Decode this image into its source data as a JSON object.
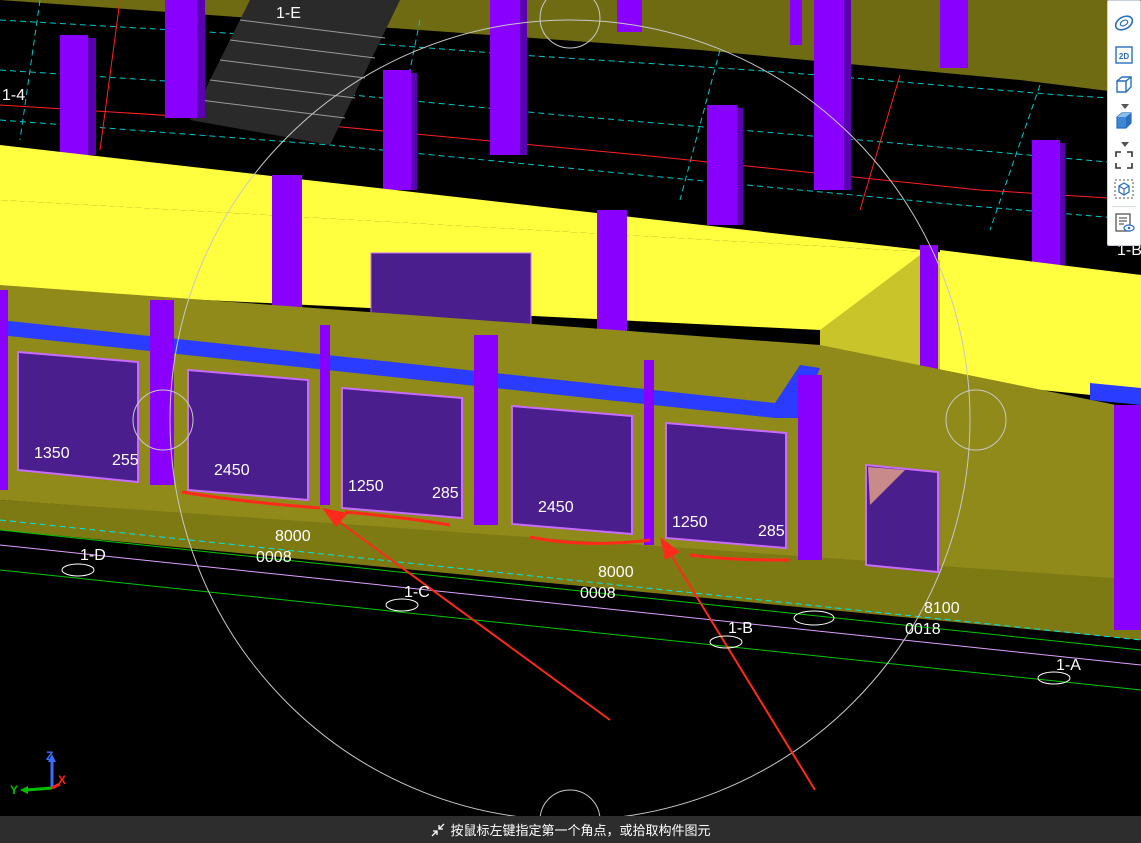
{
  "toolbar": {
    "buttons": [
      {
        "name": "dynamic-observe",
        "icon": "orbit-ellipse-icon"
      },
      {
        "name": "view-2d",
        "icon": "view-2d-icon",
        "label": "2D"
      },
      {
        "name": "view-3d",
        "icon": "cube-view-icon"
      },
      {
        "name": "view-3d-solid",
        "icon": "cube-solid-icon"
      },
      {
        "name": "zoom-extents",
        "icon": "full-screen-corners-icon"
      },
      {
        "name": "local-3d",
        "icon": "cube-in-dashed-frame-icon"
      },
      {
        "name": "display-settings",
        "icon": "document-eye-icon"
      }
    ]
  },
  "scene": {
    "axes": {
      "top": "1-E",
      "left": "1-4",
      "right": "1-B"
    },
    "grid_labels": [
      "1-D",
      "1-C",
      "1-B",
      "1-A"
    ],
    "spans": [
      "8000",
      "8000",
      "8100"
    ],
    "span_mirror": [
      "0008",
      "0008",
      "0018"
    ],
    "window_dims": [
      "1350",
      "255",
      "2450",
      "1250",
      "285",
      "2450",
      "1250",
      "285"
    ],
    "colors": {
      "background": "#000000",
      "wall_yellow": "#ffff40",
      "wall_olive": "#8f8a1a",
      "slab_olive": "#7d7a14",
      "column_purple": "#8a00ff",
      "beam_blue": "#2a3cff",
      "window_fill": "#4a1e8c",
      "window_frame": "#c86cff",
      "grid_cyan": "#00e5e5",
      "grid_green": "#00c800",
      "axis_pink": "#e0a0ff",
      "annotation_red": "#ff2a1a"
    }
  },
  "gizmo": {
    "z": "Z",
    "y": "Y",
    "x": "X"
  },
  "status": {
    "message": "按鼠标左键指定第一个角点，或拾取构件图元"
  }
}
